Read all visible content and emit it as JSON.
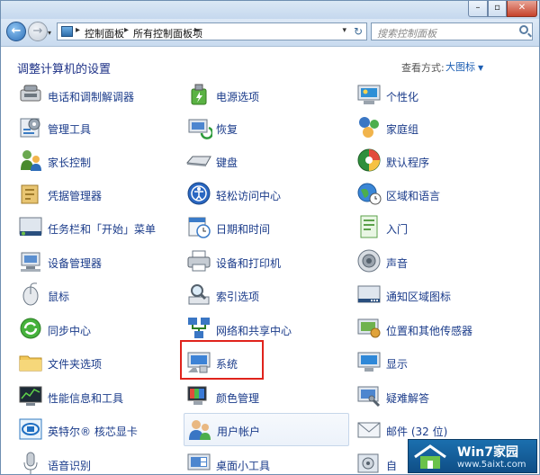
{
  "window": {
    "min_glyph": "–",
    "max_glyph": "▫",
    "close_glyph": "✕"
  },
  "nav": {
    "back_glyph": "←",
    "forward_glyph": "→",
    "dropdown_glyph": "▾",
    "breadcrumb": [
      "控制面板",
      "所有控制面板项"
    ],
    "separator": "▸",
    "refresh_glyph": "↻",
    "search_placeholder": "搜索控制面板"
  },
  "header": {
    "title": "调整计算机的设置",
    "view_label": "查看方式:",
    "view_value": "大图标",
    "view_caret": "▼"
  },
  "items": {
    "phone_modem": "电话和调制解调器",
    "power": "电源选项",
    "personalize": "个性化",
    "admin_tools": "管理工具",
    "recovery": "恢复",
    "homegroup": "家庭组",
    "parental": "家长控制",
    "keyboard": "键盘",
    "default_programs": "默认程序",
    "credential": "凭据管理器",
    "ease_access": "轻松访问中心",
    "region_lang": "区域和语言",
    "taskbar_start": "任务栏和「开始」菜单",
    "date_time": "日期和时间",
    "getting_started": "入门",
    "device_manager": "设备管理器",
    "devices_printers": "设备和打印机",
    "sound": "声音",
    "mouse": "鼠标",
    "indexing": "索引选项",
    "notify_icons": "通知区域图标",
    "sync_center": "同步中心",
    "network_sharing": "网络和共享中心",
    "location_sensors": "位置和其他传感器",
    "folder_options": "文件夹选项",
    "system": "系统",
    "display": "显示",
    "perf_info": "性能信息和工具",
    "color_mgmt": "颜色管理",
    "troubleshoot": "疑难解答",
    "intel_graphics": "英特尔® 核芯显卡",
    "user_accounts": "用户帐户",
    "mail": "邮件 (32 位)",
    "speech": "语音识别",
    "gadgets": "桌面小工具",
    "autoplay": "自"
  },
  "watermark": {
    "title": "Win7家园",
    "url": "www.5aixt.com"
  }
}
